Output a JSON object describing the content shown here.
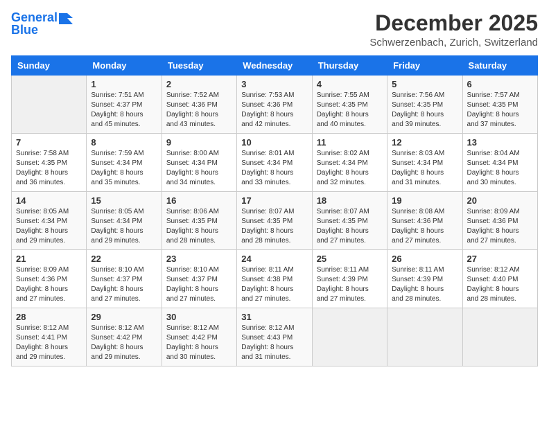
{
  "logo": {
    "line1": "General",
    "line2": "Blue"
  },
  "title": "December 2025",
  "location": "Schwerzenbach, Zurich, Switzerland",
  "days_of_week": [
    "Sunday",
    "Monday",
    "Tuesday",
    "Wednesday",
    "Thursday",
    "Friday",
    "Saturday"
  ],
  "weeks": [
    [
      {
        "day": "",
        "info": ""
      },
      {
        "day": "1",
        "info": "Sunrise: 7:51 AM\nSunset: 4:37 PM\nDaylight: 8 hours\nand 45 minutes."
      },
      {
        "day": "2",
        "info": "Sunrise: 7:52 AM\nSunset: 4:36 PM\nDaylight: 8 hours\nand 43 minutes."
      },
      {
        "day": "3",
        "info": "Sunrise: 7:53 AM\nSunset: 4:36 PM\nDaylight: 8 hours\nand 42 minutes."
      },
      {
        "day": "4",
        "info": "Sunrise: 7:55 AM\nSunset: 4:35 PM\nDaylight: 8 hours\nand 40 minutes."
      },
      {
        "day": "5",
        "info": "Sunrise: 7:56 AM\nSunset: 4:35 PM\nDaylight: 8 hours\nand 39 minutes."
      },
      {
        "day": "6",
        "info": "Sunrise: 7:57 AM\nSunset: 4:35 PM\nDaylight: 8 hours\nand 37 minutes."
      }
    ],
    [
      {
        "day": "7",
        "info": "Sunrise: 7:58 AM\nSunset: 4:35 PM\nDaylight: 8 hours\nand 36 minutes."
      },
      {
        "day": "8",
        "info": "Sunrise: 7:59 AM\nSunset: 4:34 PM\nDaylight: 8 hours\nand 35 minutes."
      },
      {
        "day": "9",
        "info": "Sunrise: 8:00 AM\nSunset: 4:34 PM\nDaylight: 8 hours\nand 34 minutes."
      },
      {
        "day": "10",
        "info": "Sunrise: 8:01 AM\nSunset: 4:34 PM\nDaylight: 8 hours\nand 33 minutes."
      },
      {
        "day": "11",
        "info": "Sunrise: 8:02 AM\nSunset: 4:34 PM\nDaylight: 8 hours\nand 32 minutes."
      },
      {
        "day": "12",
        "info": "Sunrise: 8:03 AM\nSunset: 4:34 PM\nDaylight: 8 hours\nand 31 minutes."
      },
      {
        "day": "13",
        "info": "Sunrise: 8:04 AM\nSunset: 4:34 PM\nDaylight: 8 hours\nand 30 minutes."
      }
    ],
    [
      {
        "day": "14",
        "info": "Sunrise: 8:05 AM\nSunset: 4:34 PM\nDaylight: 8 hours\nand 29 minutes."
      },
      {
        "day": "15",
        "info": "Sunrise: 8:05 AM\nSunset: 4:34 PM\nDaylight: 8 hours\nand 29 minutes."
      },
      {
        "day": "16",
        "info": "Sunrise: 8:06 AM\nSunset: 4:35 PM\nDaylight: 8 hours\nand 28 minutes."
      },
      {
        "day": "17",
        "info": "Sunrise: 8:07 AM\nSunset: 4:35 PM\nDaylight: 8 hours\nand 28 minutes."
      },
      {
        "day": "18",
        "info": "Sunrise: 8:07 AM\nSunset: 4:35 PM\nDaylight: 8 hours\nand 27 minutes."
      },
      {
        "day": "19",
        "info": "Sunrise: 8:08 AM\nSunset: 4:36 PM\nDaylight: 8 hours\nand 27 minutes."
      },
      {
        "day": "20",
        "info": "Sunrise: 8:09 AM\nSunset: 4:36 PM\nDaylight: 8 hours\nand 27 minutes."
      }
    ],
    [
      {
        "day": "21",
        "info": "Sunrise: 8:09 AM\nSunset: 4:36 PM\nDaylight: 8 hours\nand 27 minutes."
      },
      {
        "day": "22",
        "info": "Sunrise: 8:10 AM\nSunset: 4:37 PM\nDaylight: 8 hours\nand 27 minutes."
      },
      {
        "day": "23",
        "info": "Sunrise: 8:10 AM\nSunset: 4:37 PM\nDaylight: 8 hours\nand 27 minutes."
      },
      {
        "day": "24",
        "info": "Sunrise: 8:11 AM\nSunset: 4:38 PM\nDaylight: 8 hours\nand 27 minutes."
      },
      {
        "day": "25",
        "info": "Sunrise: 8:11 AM\nSunset: 4:39 PM\nDaylight: 8 hours\nand 27 minutes."
      },
      {
        "day": "26",
        "info": "Sunrise: 8:11 AM\nSunset: 4:39 PM\nDaylight: 8 hours\nand 28 minutes."
      },
      {
        "day": "27",
        "info": "Sunrise: 8:12 AM\nSunset: 4:40 PM\nDaylight: 8 hours\nand 28 minutes."
      }
    ],
    [
      {
        "day": "28",
        "info": "Sunrise: 8:12 AM\nSunset: 4:41 PM\nDaylight: 8 hours\nand 29 minutes."
      },
      {
        "day": "29",
        "info": "Sunrise: 8:12 AM\nSunset: 4:42 PM\nDaylight: 8 hours\nand 29 minutes."
      },
      {
        "day": "30",
        "info": "Sunrise: 8:12 AM\nSunset: 4:42 PM\nDaylight: 8 hours\nand 30 minutes."
      },
      {
        "day": "31",
        "info": "Sunrise: 8:12 AM\nSunset: 4:43 PM\nDaylight: 8 hours\nand 31 minutes."
      },
      {
        "day": "",
        "info": ""
      },
      {
        "day": "",
        "info": ""
      },
      {
        "day": "",
        "info": ""
      }
    ]
  ]
}
